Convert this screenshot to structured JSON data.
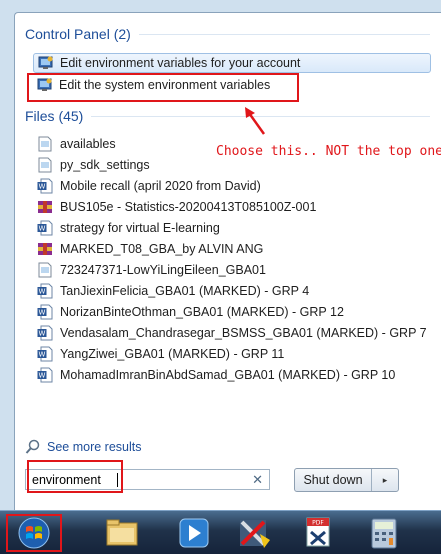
{
  "search_results": {
    "control_panel": {
      "header": "Control Panel (2)",
      "items": [
        {
          "label": "Edit environment variables for your account",
          "icon": "control-panel-icon"
        },
        {
          "label": "Edit the system environment variables",
          "icon": "control-panel-icon"
        }
      ]
    },
    "files": {
      "header": "Files (45)",
      "items": [
        {
          "label": "availables",
          "icon": "text-file-icon"
        },
        {
          "label": "py_sdk_settings",
          "icon": "text-file-icon"
        },
        {
          "label": "Mobile recall (april 2020 from David)",
          "icon": "word-document-icon"
        },
        {
          "label": "BUS105e - Statistics-20200413T085100Z-001",
          "icon": "zip-archive-icon"
        },
        {
          "label": "strategy for virtual E-learning",
          "icon": "word-document-icon"
        },
        {
          "label": "MARKED_T08_GBA_by ALVIN ANG",
          "icon": "zip-archive-icon"
        },
        {
          "label": "723247371-LowYiLingEileen_GBA01",
          "icon": "text-file-icon"
        },
        {
          "label": "TanJiexinFelicia_GBA01 (MARKED) - GRP 4",
          "icon": "word-document-icon"
        },
        {
          "label": "NorizanBinteOthman_GBA01 (MARKED) - GRP 12",
          "icon": "word-document-icon"
        },
        {
          "label": "Vendasalam_Chandrasegar_BSMSS_GBA01 (MARKED) - GRP 7",
          "icon": "word-document-icon"
        },
        {
          "label": "YangZiwei_GBA01 (MARKED) - GRP 11",
          "icon": "word-document-icon"
        },
        {
          "label": "MohamadImranBinAbdSamad_GBA01 (MARKED) - GRP 10",
          "icon": "word-document-icon"
        }
      ]
    },
    "see_more": "See more results"
  },
  "annotation": {
    "text": "Choose this.. NOT the top one!",
    "color": "#e0161a"
  },
  "search": {
    "value": "environment",
    "clear_icon": "clear-x-icon"
  },
  "shutdown": {
    "label": "Shut down",
    "arrow": "▸"
  },
  "taskbar": {
    "items": [
      {
        "name": "start-button",
        "icon": "windows-orb-icon"
      },
      {
        "name": "file-explorer",
        "icon": "folder-icon"
      },
      {
        "name": "media-player",
        "icon": "media-player-icon"
      },
      {
        "name": "tools-app",
        "icon": "tools-icon"
      },
      {
        "name": "pdf-fill-app",
        "icon": "pdf-fill-icon"
      },
      {
        "name": "calculator-app",
        "icon": "calculator-icon"
      }
    ]
  },
  "colors": {
    "group_header": "#1e4e99",
    "highlight": "#e0161a",
    "taskbar": "#20324a"
  }
}
